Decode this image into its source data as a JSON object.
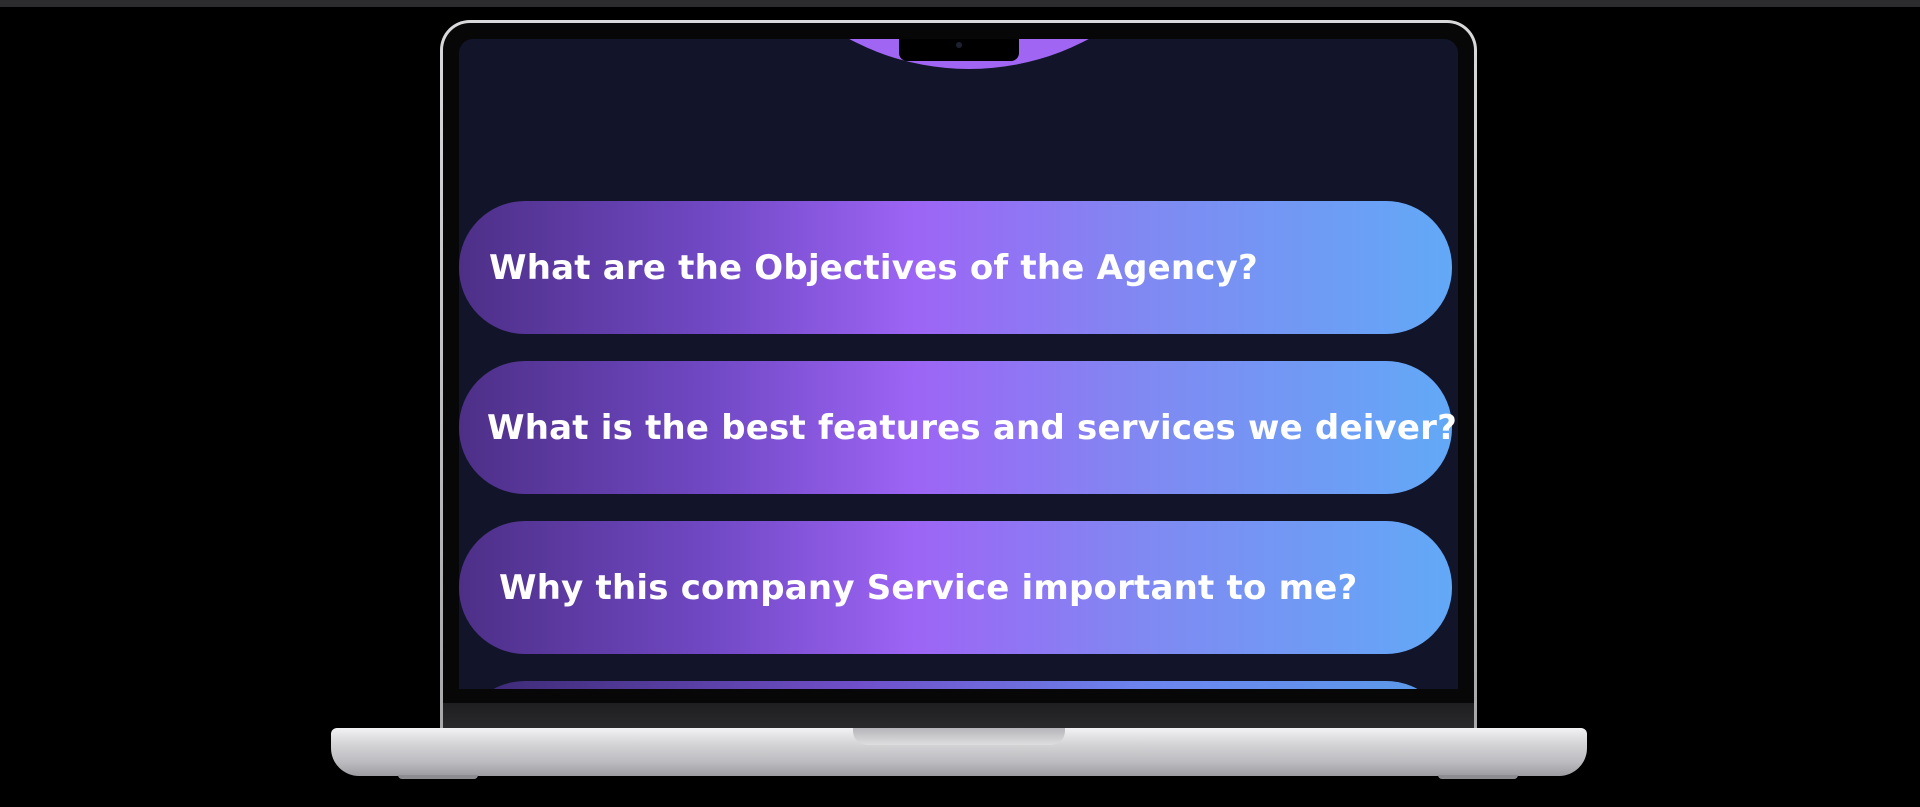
{
  "faq": {
    "items": [
      {
        "question": "What are the Objectives of the Agency?"
      },
      {
        "question": "What is the best features and services we deiver?"
      },
      {
        "question": "Why this company Service important to me?"
      }
    ]
  },
  "colors": {
    "screen_bg": "#12152a",
    "accent_purple": "#9d65f5",
    "accent_blue": "#62a9f7",
    "text": "#ffffff"
  },
  "icons": [
    "camera-icon"
  ]
}
